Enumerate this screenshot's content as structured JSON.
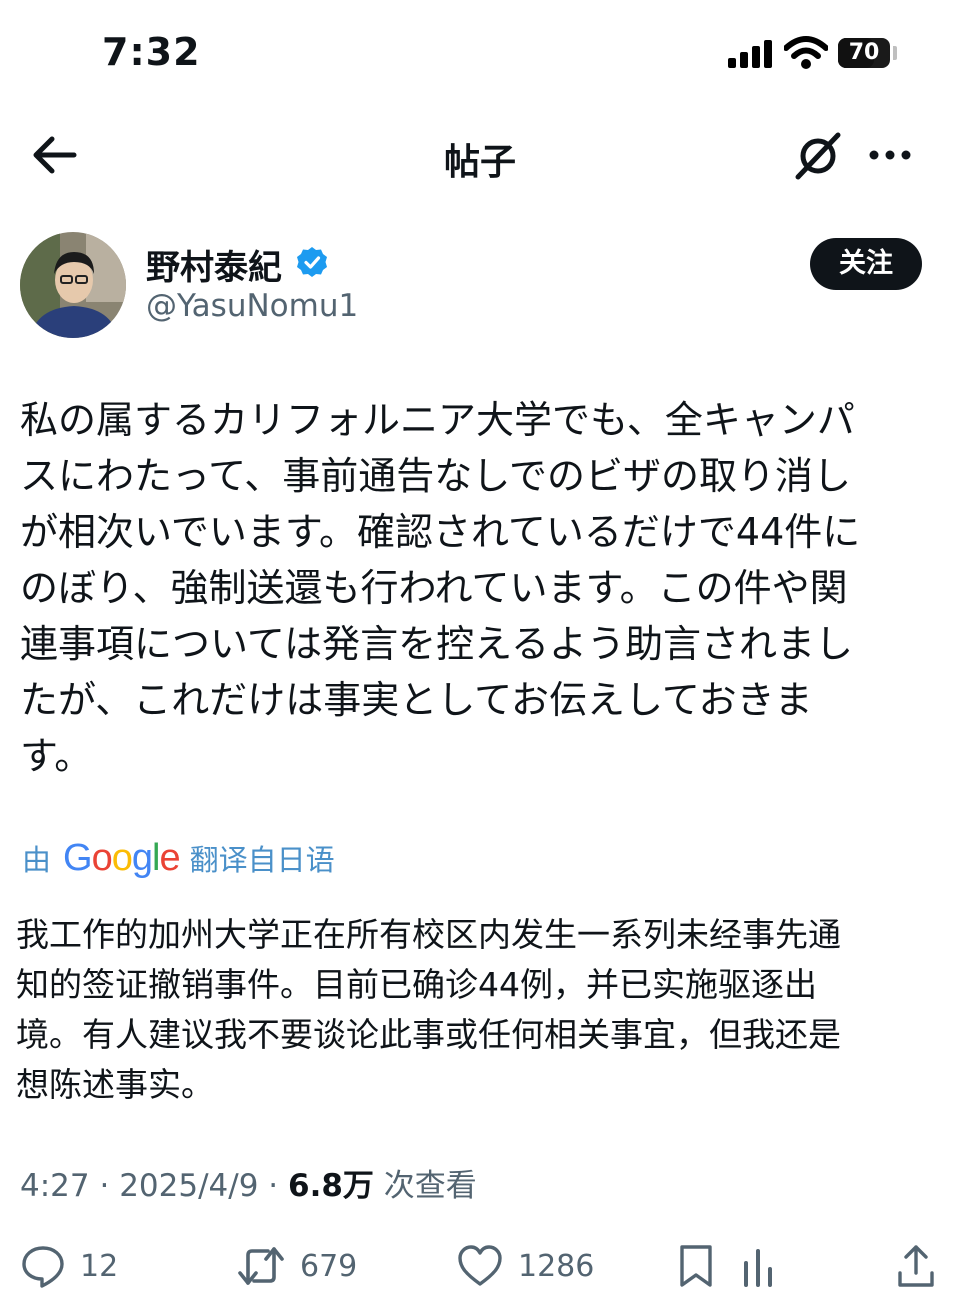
{
  "status": {
    "time": "7:32",
    "battery": "70",
    "battery_level": 0.7
  },
  "header": {
    "title": "帖子",
    "icons": [
      "back-arrow-icon",
      "grok-icon",
      "more-icon"
    ]
  },
  "author": {
    "name": "野村泰紀",
    "handle": "@YasuNomu1",
    "verified": true,
    "follow_label": "关注"
  },
  "post": {
    "lines": [
      "私の属するカリフォルニア大学でも、全キャンパ",
      "スにわたって、事前通告なしでのビザの取り消し",
      "が相次いでいます。確認されているだけで44件に",
      "のぼり、強制送還も行われています。この件や関",
      "連事項については発言を控えるよう助言されまし",
      "たが、これだけは事実としてお伝えしておきま",
      "す。"
    ],
    "translate_prefix": "由",
    "translate_brand": [
      "G",
      "o",
      "o",
      "g",
      "l",
      "e"
    ],
    "translate_suffix": "翻译自日语",
    "translation_lines": [
      "我工作的加州大学正在所有校区内发生一系列未经事先通",
      "知的签证撤销事件。目前已确诊44例，并已实施驱逐出",
      "境。有人建议我不要谈论此事或任何相关事宜，但我还是",
      "想陈述事实。"
    ]
  },
  "meta": {
    "time": "4:27",
    "sep1": "·",
    "date": "2025/4/9",
    "sep2": "·",
    "views": "6.8万",
    "views_label": "次查看"
  },
  "actions": {
    "replies": "12",
    "reposts": "679",
    "likes": "1286"
  },
  "colors": {
    "text": "#0f1419",
    "muted": "#536471",
    "verified": "#1d9bf0",
    "translate": "#4a90c9"
  }
}
